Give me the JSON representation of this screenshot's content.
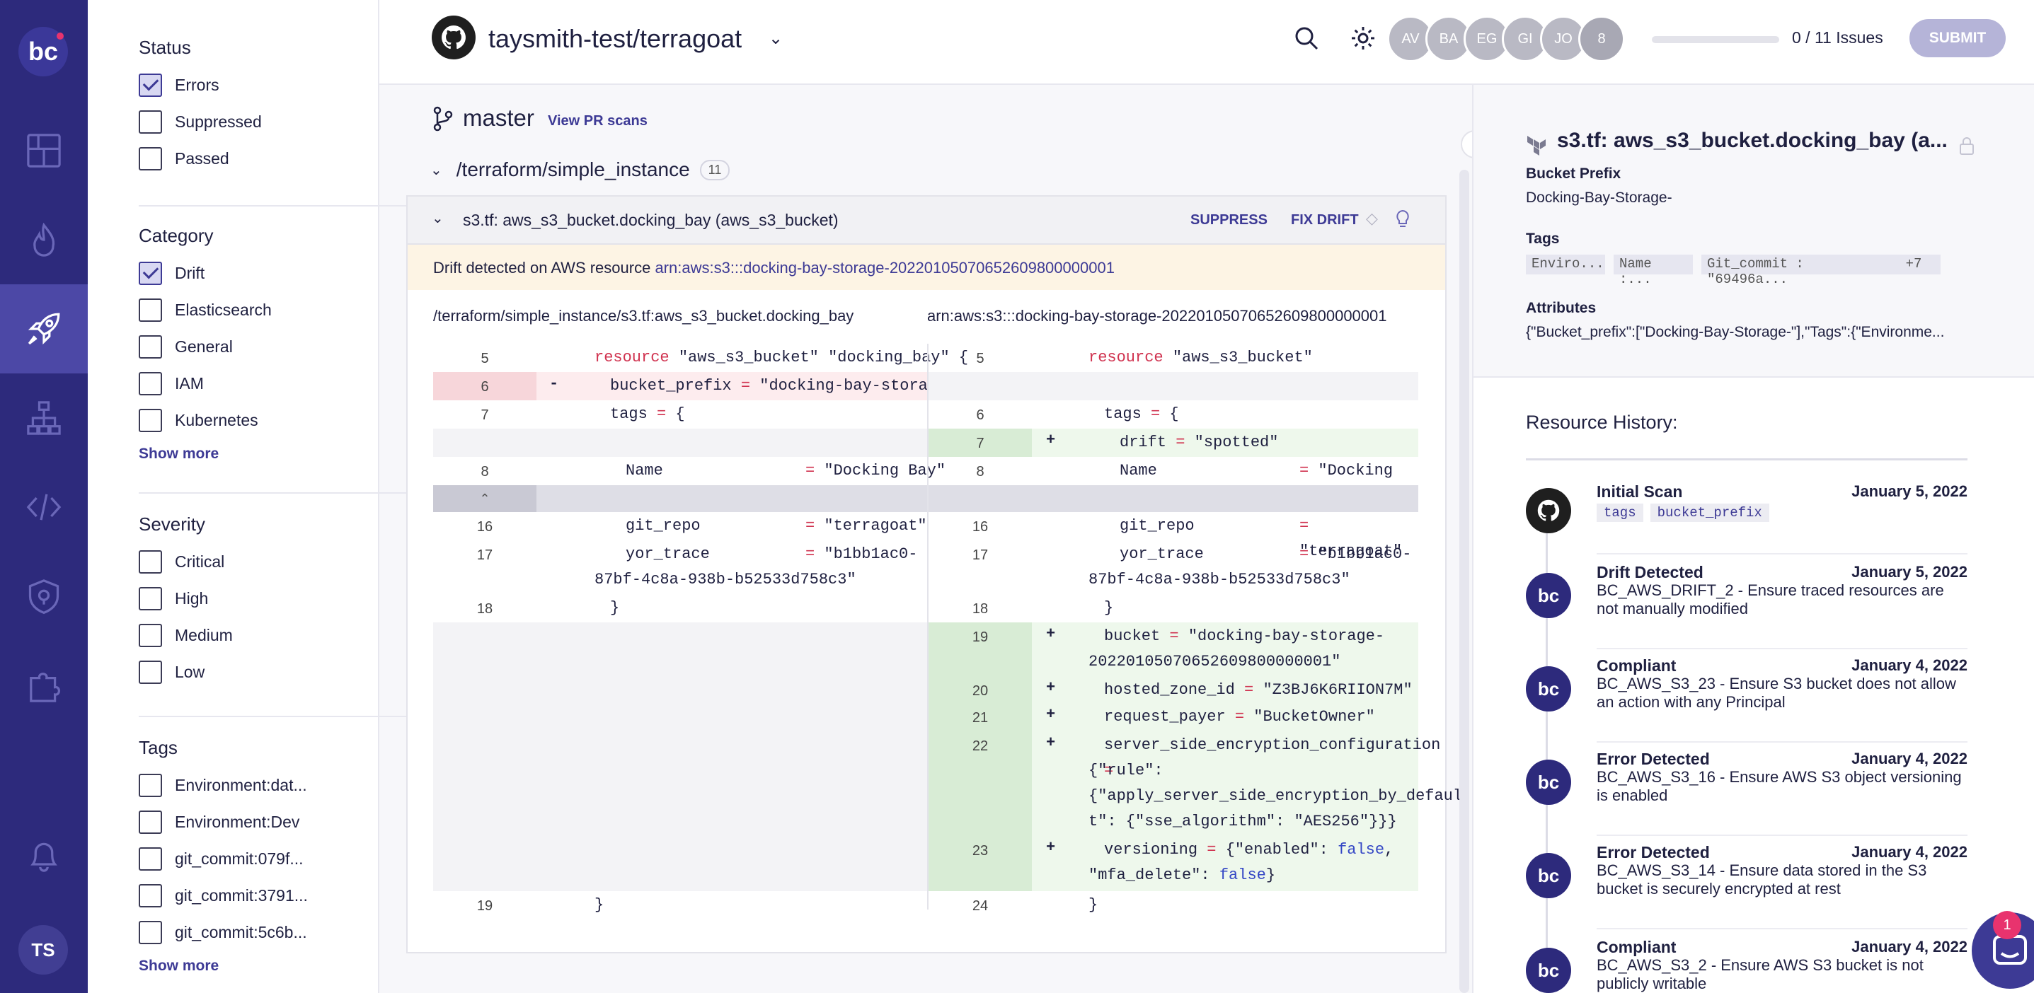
{
  "rail": {
    "logo": "bc",
    "icons": [
      "dashboard-icon",
      "fire-icon",
      "rocket-icon",
      "hierarchy-icon",
      "code-icon",
      "shield-icon",
      "puzzle-icon"
    ],
    "bell_icon": "bell-icon",
    "user_initials": "TS"
  },
  "filters": {
    "status": {
      "title": "Status",
      "items": [
        {
          "label": "Errors",
          "checked": true
        },
        {
          "label": "Suppressed",
          "checked": false
        },
        {
          "label": "Passed",
          "checked": false
        }
      ]
    },
    "category": {
      "title": "Category",
      "items": [
        {
          "label": "Drift",
          "checked": true
        },
        {
          "label": "Elasticsearch",
          "checked": false
        },
        {
          "label": "General",
          "checked": false
        },
        {
          "label": "IAM",
          "checked": false
        },
        {
          "label": "Kubernetes",
          "checked": false
        }
      ],
      "show_more": "Show more"
    },
    "severity": {
      "title": "Severity",
      "items": [
        {
          "label": "Critical",
          "checked": false
        },
        {
          "label": "High",
          "checked": false
        },
        {
          "label": "Medium",
          "checked": false
        },
        {
          "label": "Low",
          "checked": false
        }
      ]
    },
    "tags": {
      "title": "Tags",
      "items": [
        {
          "label": "Environment:dat...",
          "checked": false
        },
        {
          "label": "Environment:Dev",
          "checked": false
        },
        {
          "label": "git_commit:079f...",
          "checked": false
        },
        {
          "label": "git_commit:3791...",
          "checked": false
        },
        {
          "label": "git_commit:5c6b...",
          "checked": false
        }
      ],
      "show_more": "Show more"
    }
  },
  "header": {
    "repo": "taysmith-test/terragoat",
    "avatars": [
      "AV",
      "BA",
      "EG",
      "GI",
      "JO",
      "8"
    ],
    "progress": 0,
    "issues": "0 / 11 Issues",
    "submit": "SUBMIT"
  },
  "main": {
    "branch": "master",
    "pr_link": "View PR scans",
    "path": "/terraform/simple_instance",
    "path_count": "11",
    "card_title": "s3.tf: aws_s3_bucket.docking_bay (aws_s3_bucket)",
    "suppress": "SUPPRESS",
    "fix_drift": "FIX DRIFT",
    "banner_prefix": "Drift detected on AWS resource ",
    "banner_arn": "arn:aws:s3:::docking-bay-storage-20220105070652609800000001",
    "left_head": "/terraform/simple_instance/s3.tf:aws_s3_bucket.docking_bay",
    "right_head": "arn:aws:s3:::docking-bay-storage-20220105070652609800000001"
  },
  "diff": {
    "l5": "5",
    "l6": "6",
    "l7": "7",
    "l8": "8",
    "l16": "16",
    "l17": "17",
    "l18": "18",
    "l19": "19",
    "r5": "5",
    "r6": "6",
    "r7": "7",
    "r8": "8",
    "r16": "16",
    "r17": "17",
    "r18": "18",
    "r19": "19",
    "r20": "20",
    "r21": "21",
    "r22": "22",
    "r23": "23",
    "r24": "24",
    "minus": "-",
    "plus": "+",
    "kw_resource": "resource",
    "s3_type": "\"aws_s3_bucket\" \"docking_bay\" {",
    "bucket_prefix": "bucket_prefix",
    "eq": "=",
    "bucket_prefix_val": "\"docking-bay-storage-\"",
    "tags_open": "tags",
    "brace_open": "{",
    "drift_key": "drift",
    "drift_val": "\"spotted\"",
    "name_key": "Name",
    "name_val": "\"Docking Bay\"",
    "repo_key": "git_repo",
    "repo_val": "\"terragoat\"",
    "trace_key": "yor_trace",
    "trace_val": "\"b1bb1ac0-",
    "trace_val2": "87bf-4c8a-938b-b52533d758c3\"",
    "brace_close": "}",
    "bucket_key": "bucket",
    "bucket_val": "\"docking-bay-storage-",
    "bucket_val2": "20220105070652609800000001\"",
    "zone_key": "hosted_zone_id",
    "zone_val": "\"Z3BJ6K6RIION7M\"",
    "payer_key": "request_payer",
    "payer_val": "\"BucketOwner\"",
    "sse_key": "server_side_encryption_configuration",
    "sse_val1": "{\"rule\":",
    "sse_val2": "{\"apply_server_side_encryption_by_defaul",
    "sse_val3": "t\": {\"sse_algorithm\": \"AES256\"}}}",
    "ver_key": "versioning",
    "ver_val_a": "{\"enabled\": ",
    "false1": "false",
    "comma": ",",
    "ver_val_b": "\"mfa_delete\": ",
    "false2": "false",
    "close_b": "}"
  },
  "right": {
    "title": "s3.tf: aws_s3_bucket.docking_bay (a...",
    "prefix_label": "Bucket Prefix",
    "prefix_value": "Docking-Bay-Storage-",
    "tags_label": "Tags",
    "tags": [
      "Enviro...",
      "Name :...",
      "Git_commit : \"69496a...",
      "+7"
    ],
    "attr_label": "Attributes",
    "attr_value": "{\"Bucket_prefix\":[\"Docking-Bay-Storage-\"],\"Tags\":{\"Environme...",
    "history_title": "Resource History:",
    "events": [
      {
        "title": "Initial Scan",
        "date": "January 5, 2022",
        "tags": [
          "tags",
          "bucket_prefix"
        ]
      },
      {
        "title": "Drift Detected",
        "date": "January 5, 2022",
        "desc": "BC_AWS_DRIFT_2 - Ensure traced resources are not manually modified"
      },
      {
        "title": "Compliant",
        "date": "January 4, 2022",
        "desc": "BC_AWS_S3_23 - Ensure S3 bucket does not allow an action with any Principal"
      },
      {
        "title": "Error Detected",
        "date": "January 4, 2022",
        "desc": "BC_AWS_S3_16 - Ensure AWS S3 object versioning is enabled"
      },
      {
        "title": "Error Detected",
        "date": "January 4, 2022",
        "desc": "BC_AWS_S3_14 - Ensure data stored in the S3 bucket is securely encrypted at rest"
      },
      {
        "title": "Compliant",
        "date": "January 4, 2022",
        "desc": "BC_AWS_S3_2 - Ensure AWS S3 bucket is not publicly writable"
      }
    ],
    "event_logo": "bc"
  },
  "chat_badge": "1",
  "colors": {
    "brand": "#2d2a7c",
    "accent": "#3d3a95",
    "drift_banner": "#fdf4e4"
  }
}
